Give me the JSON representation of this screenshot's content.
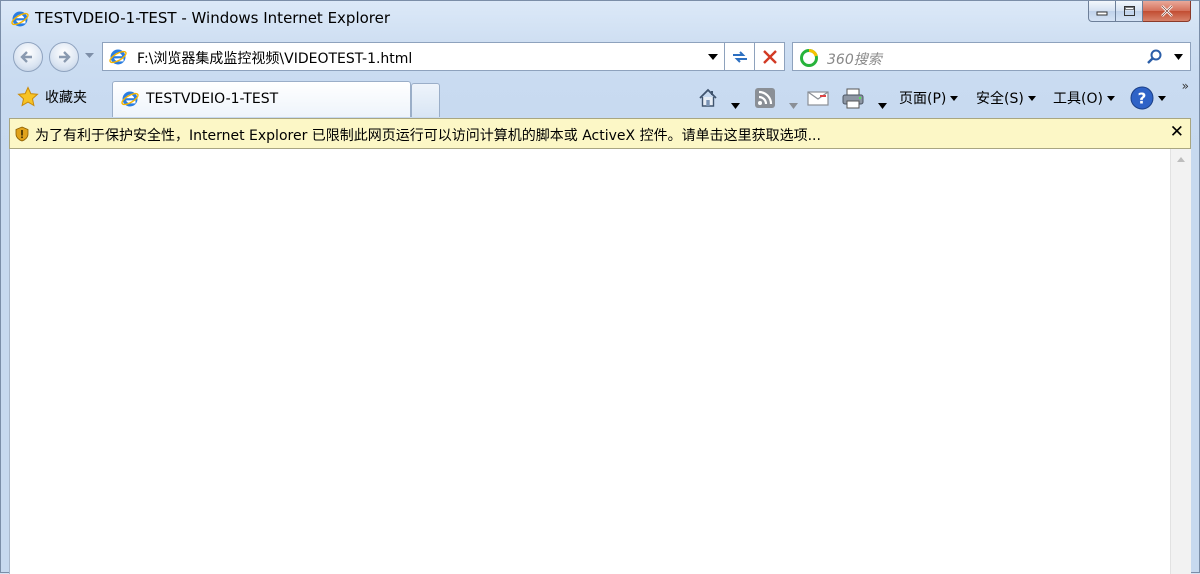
{
  "window": {
    "title": "TESTVDEIO-1-TEST - Windows Internet Explorer"
  },
  "address_bar": {
    "url": "F:\\浏览器集成监控视频\\VIDEOTEST-1.html"
  },
  "search": {
    "placeholder": "360搜索"
  },
  "favorites": {
    "label": "收藏夹"
  },
  "tabs": [
    {
      "label": "TESTVDEIO-1-TEST",
      "active": true
    }
  ],
  "command_bar": {
    "page_label": "页面(P)",
    "safety_label": "安全(S)",
    "tools_label": "工具(O)"
  },
  "info_bar": {
    "message": "为了有利于保护安全性，Internet Explorer 已限制此网页运行可以访问计算机的脚本或 ActiveX 控件。请单击这里获取选项..."
  },
  "icons": {
    "title": "ie-logo-icon",
    "home": "home-icon",
    "feeds": "rss-icon",
    "mail": "mail-icon",
    "print": "printer-icon",
    "help": "help-icon"
  },
  "colors": {
    "info_bar_bg": "#fcf7c6",
    "ie_blue": "#1e6fd9",
    "close_red": "#c24d32"
  }
}
